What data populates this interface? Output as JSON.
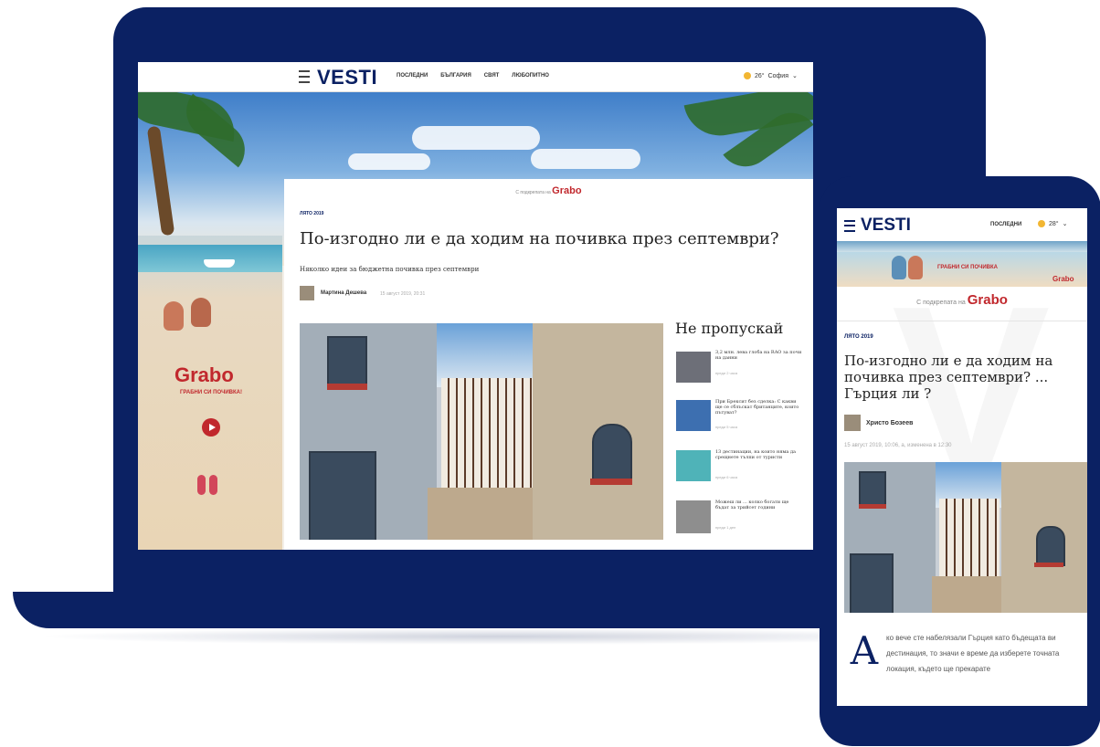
{
  "desktop": {
    "header": {
      "logo": "VESTI",
      "nav": [
        "ПОСЛЕДНИ",
        "БЪЛГАРИЯ",
        "СВЯТ",
        "ЛЮБОПИТНО"
      ],
      "weather": {
        "temp": "26°",
        "city": "София"
      }
    },
    "side_banner": {
      "brand": "Grabo",
      "tagline": "ГРАБНИ СИ ПОЧИВКА!"
    },
    "article": {
      "presented_by": "С подкрепата на",
      "sponsor": "Grabo",
      "category": "ЛЯТО 2019",
      "title": "По-изгодно ли е да ходим на почивка през септември?",
      "lead": "Няколко идеи за бюджетна почивка през септември",
      "author": "Мартина Дешева",
      "date": "15 август 2019, 20:31"
    },
    "sidebar": {
      "title": "Не пропускай",
      "items": [
        {
          "text": "3,2 млн. лева глоба на RAO за почи на данни",
          "date": "преди 2 часа"
        },
        {
          "text": "При Брексит без сделка: С какви ще се сблъскат британците, които пътуват?",
          "date": "преди 5 часа"
        },
        {
          "text": "13 дестинации, на които няма да срещнете тълпи от туристи",
          "date": "преди 6 часа"
        },
        {
          "text": "Можеш ли ... колко богати ще бъдат за трийсет години",
          "date": "преди 1 ден"
        }
      ]
    }
  },
  "mobile": {
    "logo": "VESTI",
    "nav": "ПОСЛЕДНИ",
    "weather": {
      "temp": "28°"
    },
    "banner_text": "ГРАБНИ СИ ПОЧИВКА",
    "banner_brand": "Grabo",
    "presented_by": "С подкрепата на",
    "sponsor": "Grabo",
    "category": "ЛЯТО 2019",
    "title": "По-изгодно ли е да ходим на почивка през септември? ... Гърция ли ?",
    "author": "Христо Бозеев",
    "date": "15 август 2019, 10:06, а, изменена в 12:30",
    "dropcap": "А",
    "body": "ко вече сте набелязали Гърция като бъдещата ви дестинация, то значи е време да изберете точната локация, където ще прекарате"
  },
  "colors": {
    "brand_navy": "#0b2163",
    "grabo_red": "#c1282d"
  }
}
